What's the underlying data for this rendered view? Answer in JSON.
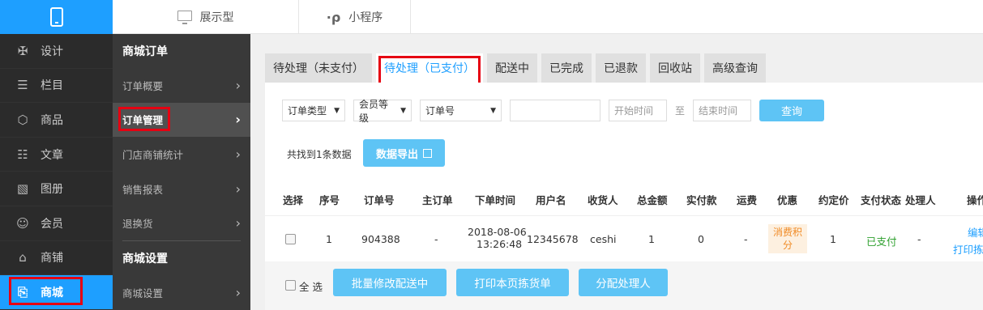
{
  "topbar": {
    "tabs": [
      {
        "label": "展示型",
        "icon": "monitor-icon"
      },
      {
        "label": "小程序",
        "icon": "mini-program-icon"
      }
    ]
  },
  "leftnav": {
    "items": [
      {
        "label": "设计",
        "icon": "design-icon"
      },
      {
        "label": "栏目",
        "icon": "list-icon"
      },
      {
        "label": "商品",
        "icon": "box-icon"
      },
      {
        "label": "文章",
        "icon": "article-icon"
      },
      {
        "label": "图册",
        "icon": "image-icon"
      },
      {
        "label": "会员",
        "icon": "user-icon"
      },
      {
        "label": "商铺",
        "icon": "shop-icon"
      },
      {
        "label": "商城",
        "icon": "clipboard-icon"
      }
    ]
  },
  "subnav": {
    "section1": "商城订单",
    "items1": [
      "订单概要",
      "订单管理",
      "门店商铺统计",
      "销售报表",
      "退换货"
    ],
    "section2": "商城设置",
    "items2": [
      "商城设置"
    ]
  },
  "tabs": [
    "待处理（未支付）",
    "待处理（已支付）",
    "配送中",
    "已完成",
    "已退款",
    "回收站",
    "高级查询"
  ],
  "filters": {
    "order_type": "订单类型",
    "member_level": "会员等级",
    "order_no": "订单号",
    "start_time": "开始时间",
    "to": "至",
    "end_time": "结束时间",
    "query": "查询"
  },
  "found_text": "共找到1条数据",
  "export_label": "数据导出",
  "table": {
    "headers": [
      "选择",
      "序号",
      "订单号",
      "主订单",
      "下单时间",
      "用户名",
      "收货人",
      "总金额",
      "实付款",
      "运费",
      "优惠",
      "约定价",
      "支付状态",
      "处理人",
      "操作"
    ],
    "row": {
      "index": "1",
      "order_no": "904388",
      "main_order": "-",
      "date": "2018-08-06",
      "time": "13:26:48",
      "username": "12345678",
      "receiver": "ceshi",
      "total": "1",
      "paid_amount": "0",
      "freight": "-",
      "discount_line1": "消费积",
      "discount_line2": "分",
      "agreed_price": "1",
      "pay_status": "已支付",
      "handler": "-",
      "op_edit": "编辑",
      "op_print": "打印拣"
    }
  },
  "bottom": {
    "select_all": "全 选",
    "batch_delivery": "批量修改配送中",
    "print_pick": "打印本页拣货单",
    "assign_handler": "分配处理人"
  },
  "colors": {
    "accent": "#1e9fff",
    "button": "#5ec4f5",
    "highlight_box": "#e60012"
  }
}
